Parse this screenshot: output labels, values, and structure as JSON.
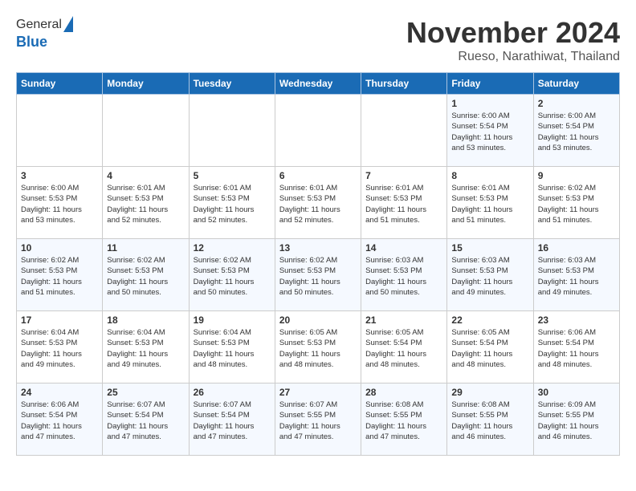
{
  "header": {
    "logo_line1": "General",
    "logo_line2": "Blue",
    "month": "November 2024",
    "location": "Rueso, Narathiwat, Thailand"
  },
  "weekdays": [
    "Sunday",
    "Monday",
    "Tuesday",
    "Wednesday",
    "Thursday",
    "Friday",
    "Saturday"
  ],
  "weeks": [
    [
      {
        "day": "",
        "info": ""
      },
      {
        "day": "",
        "info": ""
      },
      {
        "day": "",
        "info": ""
      },
      {
        "day": "",
        "info": ""
      },
      {
        "day": "",
        "info": ""
      },
      {
        "day": "1",
        "info": "Sunrise: 6:00 AM\nSunset: 5:54 PM\nDaylight: 11 hours\nand 53 minutes."
      },
      {
        "day": "2",
        "info": "Sunrise: 6:00 AM\nSunset: 5:54 PM\nDaylight: 11 hours\nand 53 minutes."
      }
    ],
    [
      {
        "day": "3",
        "info": "Sunrise: 6:00 AM\nSunset: 5:53 PM\nDaylight: 11 hours\nand 53 minutes."
      },
      {
        "day": "4",
        "info": "Sunrise: 6:01 AM\nSunset: 5:53 PM\nDaylight: 11 hours\nand 52 minutes."
      },
      {
        "day": "5",
        "info": "Sunrise: 6:01 AM\nSunset: 5:53 PM\nDaylight: 11 hours\nand 52 minutes."
      },
      {
        "day": "6",
        "info": "Sunrise: 6:01 AM\nSunset: 5:53 PM\nDaylight: 11 hours\nand 52 minutes."
      },
      {
        "day": "7",
        "info": "Sunrise: 6:01 AM\nSunset: 5:53 PM\nDaylight: 11 hours\nand 51 minutes."
      },
      {
        "day": "8",
        "info": "Sunrise: 6:01 AM\nSunset: 5:53 PM\nDaylight: 11 hours\nand 51 minutes."
      },
      {
        "day": "9",
        "info": "Sunrise: 6:02 AM\nSunset: 5:53 PM\nDaylight: 11 hours\nand 51 minutes."
      }
    ],
    [
      {
        "day": "10",
        "info": "Sunrise: 6:02 AM\nSunset: 5:53 PM\nDaylight: 11 hours\nand 51 minutes."
      },
      {
        "day": "11",
        "info": "Sunrise: 6:02 AM\nSunset: 5:53 PM\nDaylight: 11 hours\nand 50 minutes."
      },
      {
        "day": "12",
        "info": "Sunrise: 6:02 AM\nSunset: 5:53 PM\nDaylight: 11 hours\nand 50 minutes."
      },
      {
        "day": "13",
        "info": "Sunrise: 6:02 AM\nSunset: 5:53 PM\nDaylight: 11 hours\nand 50 minutes."
      },
      {
        "day": "14",
        "info": "Sunrise: 6:03 AM\nSunset: 5:53 PM\nDaylight: 11 hours\nand 50 minutes."
      },
      {
        "day": "15",
        "info": "Sunrise: 6:03 AM\nSunset: 5:53 PM\nDaylight: 11 hours\nand 49 minutes."
      },
      {
        "day": "16",
        "info": "Sunrise: 6:03 AM\nSunset: 5:53 PM\nDaylight: 11 hours\nand 49 minutes."
      }
    ],
    [
      {
        "day": "17",
        "info": "Sunrise: 6:04 AM\nSunset: 5:53 PM\nDaylight: 11 hours\nand 49 minutes."
      },
      {
        "day": "18",
        "info": "Sunrise: 6:04 AM\nSunset: 5:53 PM\nDaylight: 11 hours\nand 49 minutes."
      },
      {
        "day": "19",
        "info": "Sunrise: 6:04 AM\nSunset: 5:53 PM\nDaylight: 11 hours\nand 48 minutes."
      },
      {
        "day": "20",
        "info": "Sunrise: 6:05 AM\nSunset: 5:53 PM\nDaylight: 11 hours\nand 48 minutes."
      },
      {
        "day": "21",
        "info": "Sunrise: 6:05 AM\nSunset: 5:54 PM\nDaylight: 11 hours\nand 48 minutes."
      },
      {
        "day": "22",
        "info": "Sunrise: 6:05 AM\nSunset: 5:54 PM\nDaylight: 11 hours\nand 48 minutes."
      },
      {
        "day": "23",
        "info": "Sunrise: 6:06 AM\nSunset: 5:54 PM\nDaylight: 11 hours\nand 48 minutes."
      }
    ],
    [
      {
        "day": "24",
        "info": "Sunrise: 6:06 AM\nSunset: 5:54 PM\nDaylight: 11 hours\nand 47 minutes."
      },
      {
        "day": "25",
        "info": "Sunrise: 6:07 AM\nSunset: 5:54 PM\nDaylight: 11 hours\nand 47 minutes."
      },
      {
        "day": "26",
        "info": "Sunrise: 6:07 AM\nSunset: 5:54 PM\nDaylight: 11 hours\nand 47 minutes."
      },
      {
        "day": "27",
        "info": "Sunrise: 6:07 AM\nSunset: 5:55 PM\nDaylight: 11 hours\nand 47 minutes."
      },
      {
        "day": "28",
        "info": "Sunrise: 6:08 AM\nSunset: 5:55 PM\nDaylight: 11 hours\nand 47 minutes."
      },
      {
        "day": "29",
        "info": "Sunrise: 6:08 AM\nSunset: 5:55 PM\nDaylight: 11 hours\nand 46 minutes."
      },
      {
        "day": "30",
        "info": "Sunrise: 6:09 AM\nSunset: 5:55 PM\nDaylight: 11 hours\nand 46 minutes."
      }
    ]
  ]
}
